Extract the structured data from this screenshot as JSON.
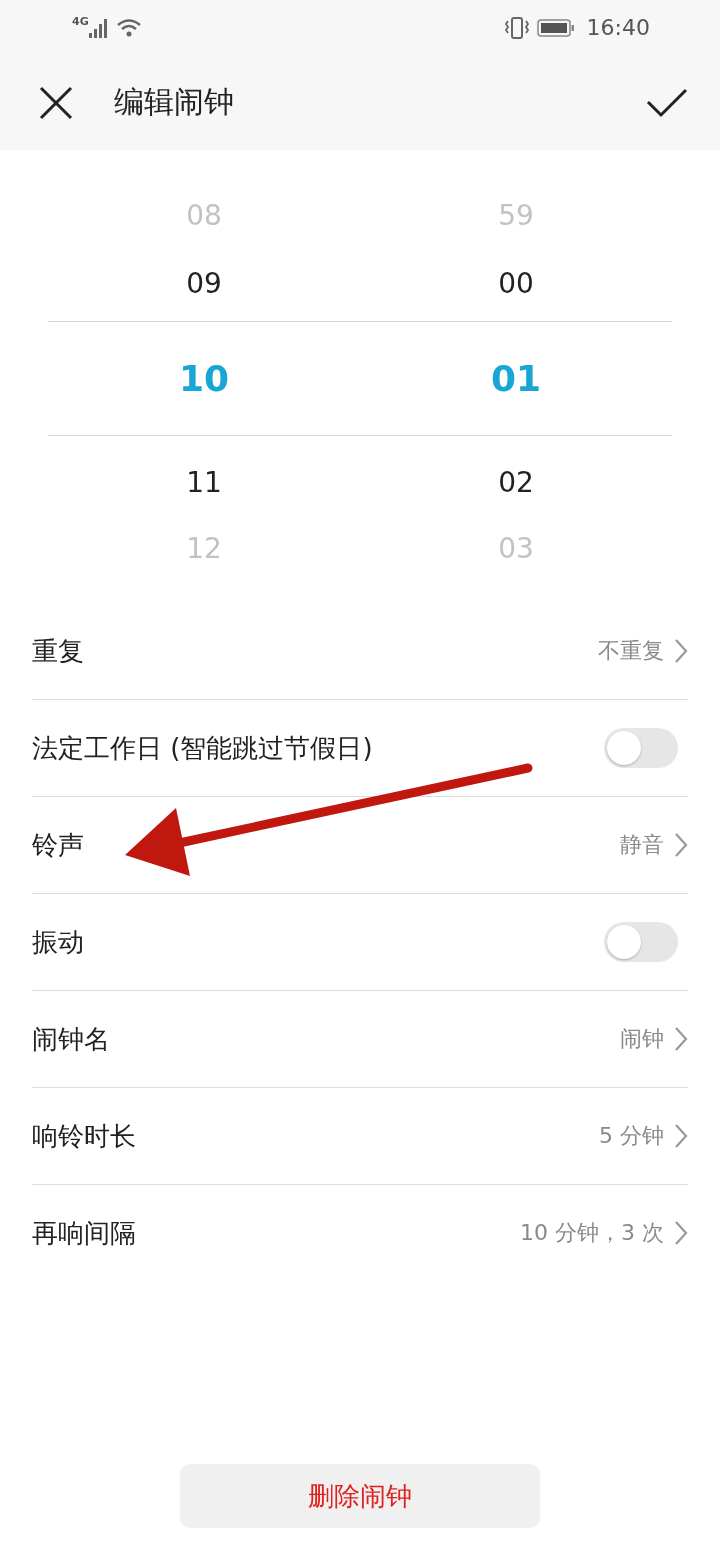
{
  "status_bar": {
    "network": "4G",
    "time": "16:40"
  },
  "header": {
    "title": "编辑闹钟"
  },
  "picker": {
    "columns": [
      {
        "values": [
          {
            "text": "08",
            "selected": false
          },
          {
            "text": "09",
            "selected": false
          },
          {
            "text": "10",
            "selected": true
          },
          {
            "text": "11",
            "selected": false
          },
          {
            "text": "12",
            "selected": false
          }
        ]
      },
      {
        "values": [
          {
            "text": "59",
            "selected": false
          },
          {
            "text": "00",
            "selected": false
          },
          {
            "text": "01",
            "selected": true
          },
          {
            "text": "02",
            "selected": false
          },
          {
            "text": "03",
            "selected": false
          }
        ]
      }
    ]
  },
  "settings": [
    {
      "kind": "link",
      "label": "重复",
      "value": "不重复"
    },
    {
      "kind": "toggle",
      "label": "法定工作日 (智能跳过节假日)",
      "on": false
    },
    {
      "kind": "link",
      "label": "铃声",
      "value": "静音"
    },
    {
      "kind": "toggle",
      "label": "振动",
      "on": false
    },
    {
      "kind": "link",
      "label": "闹钟名",
      "value": "闹钟"
    },
    {
      "kind": "link",
      "label": "响铃时长",
      "value": "5 分钟"
    },
    {
      "kind": "link",
      "label": "再响间隔",
      "value": "10 分钟，3 次"
    }
  ],
  "delete_button": "删除闹钟"
}
